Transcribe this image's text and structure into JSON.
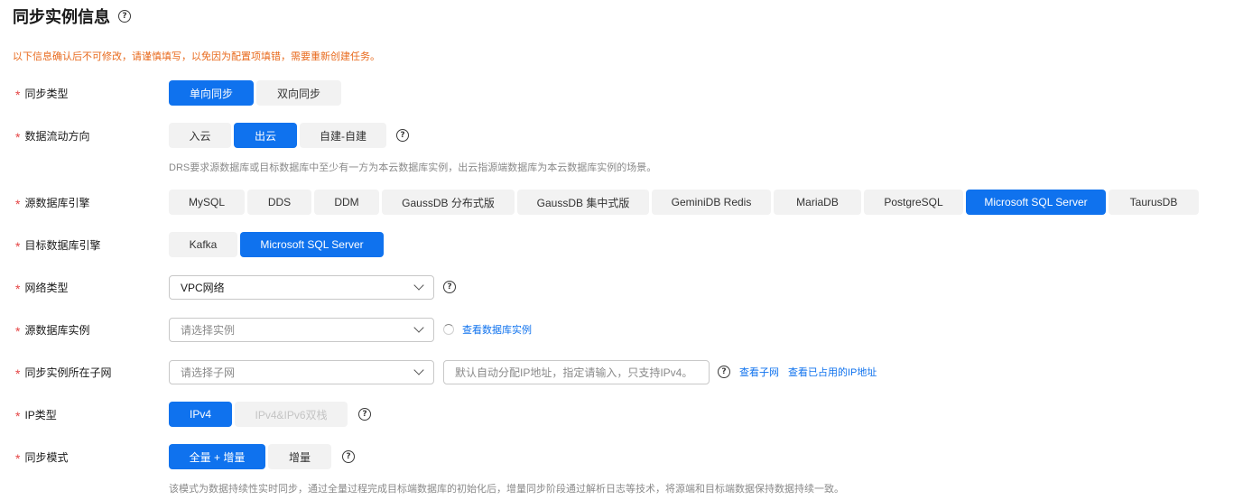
{
  "title": "同步实例信息",
  "warning": "以下信息确认后不可修改，请谨慎填写，以免因为配置项填错，需要重新创建任务。",
  "sync_type": {
    "label": "同步类型",
    "options": [
      "单向同步",
      "双向同步"
    ],
    "selected": "单向同步"
  },
  "flow_direction": {
    "label": "数据流动方向",
    "options": [
      "入云",
      "出云",
      "自建-自建"
    ],
    "selected": "出云",
    "hint": "DRS要求源数据库或目标数据库中至少有一方为本云数据库实例，出云指源端数据库为本云数据库实例的场景。"
  },
  "source_engine": {
    "label": "源数据库引擎",
    "options": [
      "MySQL",
      "DDS",
      "DDM",
      "GaussDB 分布式版",
      "GaussDB 集中式版",
      "GeminiDB Redis",
      "MariaDB",
      "PostgreSQL",
      "Microsoft SQL Server",
      "TaurusDB"
    ],
    "selected": "Microsoft SQL Server"
  },
  "target_engine": {
    "label": "目标数据库引擎",
    "options": [
      "Kafka",
      "Microsoft SQL Server"
    ],
    "selected": "Microsoft SQL Server"
  },
  "network_type": {
    "label": "网络类型",
    "value": "VPC网络"
  },
  "source_instance": {
    "label": "源数据库实例",
    "placeholder": "请选择实例",
    "link": "查看数据库实例"
  },
  "subnet": {
    "label": "同步实例所在子网",
    "placeholder": "请选择子网",
    "ip_placeholder": "默认自动分配IP地址，指定请输入，只支持IPv4。",
    "link_subnet": "查看子网",
    "link_used_ip": "查看已占用的IP地址"
  },
  "ip_type": {
    "label": "IP类型",
    "options": [
      "IPv4",
      "IPv4&IPv6双栈"
    ],
    "selected": "IPv4"
  },
  "sync_mode": {
    "label": "同步模式",
    "options": [
      "全量 + 增量",
      "增量"
    ],
    "selected": "全量 + 增量",
    "hint": "该模式为数据持续性实时同步，通过全量过程完成目标端数据库的初始化后，增量同步阶段通过解析日志等技术，将源端和目标端数据保持数据持续一致。"
  },
  "help_glyph": "?",
  "required_mark": "*",
  "colors": {
    "primary": "#0f72ee",
    "warning": "#e86a1d",
    "required": "#e54545"
  }
}
